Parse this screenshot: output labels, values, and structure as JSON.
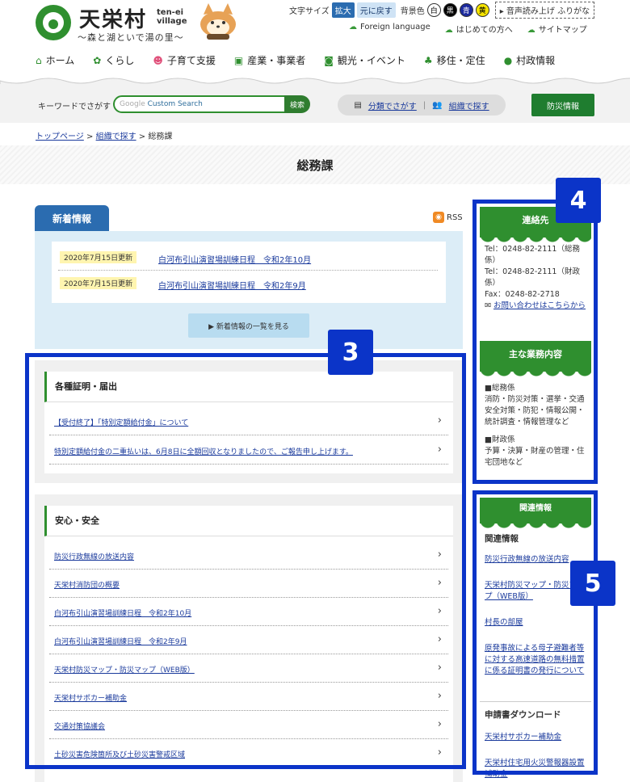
{
  "header": {
    "logo_title": "天栄村",
    "logo_roman_1": "ten-ei",
    "logo_roman_2": "village",
    "logo_sub": "～森と湖といで湯の里～",
    "tools": {
      "font_size_label": "文字サイズ",
      "enlarge": "拡大",
      "reset": "元に戻す",
      "bg_label": "背景色",
      "bg_white": "白",
      "bg_black": "黒",
      "bg_blue": "青",
      "bg_yellow": "黄",
      "voice": "▸ 音声読み上げ ふりがな"
    },
    "sublinks": [
      "Foreign language",
      "はじめての方へ",
      "サイトマップ"
    ],
    "nav": [
      "ホーム",
      "くらし",
      "子育て支援",
      "産業・事業者",
      "観光・イベント",
      "移住・定住",
      "村政情報"
    ]
  },
  "search": {
    "label": "キーワードでさがす",
    "placeholder_brand": "Google",
    "placeholder": "Custom Search",
    "button": "検索",
    "category": "分類でさがす",
    "organization": "組織で探す",
    "bousai": "防災情報"
  },
  "breadcrumb": {
    "top": "トップページ",
    "org": "組織で探す",
    "current": "総務課",
    "sep": ">"
  },
  "page_title": "総務課",
  "news": {
    "tab": "新着情報",
    "rss": "RSS",
    "items": [
      {
        "date": "2020年7月15日更新",
        "title": "白河布引山演習場訓練日程　令和2年10月"
      },
      {
        "date": "2020年7月15日更新",
        "title": "白河布引山演習場訓練日程　令和2年9月"
      }
    ],
    "more": "▶ 新着情報の一覧を見る"
  },
  "sections": [
    {
      "title": "各種証明・届出",
      "links": [
        "【受付終了】「特別定額給付金」について",
        "特別定額給付金の二重払いは、6月8日に全額回収となりましたので、ご報告申し上げます。"
      ]
    },
    {
      "title": "安心・安全",
      "links": [
        "防災行政無線の放送内容",
        "天栄村消防団の概要",
        "白河布引山演習場訓練日程　令和2年10月",
        "白河布引山演習場訓練日程　令和2年9月",
        "天栄村防災マップ・防災マップ（WEB版）",
        "天栄村サポカー補助金",
        "交通対策協議会",
        "土砂災害危険箇所及び土砂災害警戒区域"
      ]
    }
  ],
  "sidebar": {
    "contact_head": "連絡先",
    "contact_lines": [
      "Tel：0248-82-2111（総務係）",
      "Tel：0248-82-2111（財政係）",
      "Fax：0248-82-2718"
    ],
    "contact_link": "お問い合わせはこちらから",
    "duties_head": "主な業務内容",
    "duties_1_title": "■総務係",
    "duties_1_text": "消防・防災対策・選挙・交通安全対策・防犯・情報公開・統計調査・情報管理など",
    "duties_2_title": "■財政係",
    "duties_2_text": "予算・決算・財産の管理・住宅団地など",
    "related_head": "関連情報",
    "related_sub": "関連情報",
    "related_links": [
      "防災行政無線の放送内容",
      "天栄村防災マップ・防災マップ（WEB版）",
      "村長の部屋",
      "原発事故による母子避難者等に対する高速道路の無料措置に係る証明書の発行について"
    ],
    "download_sub": "申請書ダウンロード",
    "download_links": [
      "天栄村サポカー補助金",
      "天栄村住宅用火災警報器設置補助金"
    ]
  },
  "annotations": {
    "box3": "3",
    "box4": "4",
    "box5": "5"
  },
  "colors": {
    "brand_green": "#2f8f2f",
    "news_blue": "#2b6cb0",
    "annotation_blue": "#0b34c8"
  }
}
